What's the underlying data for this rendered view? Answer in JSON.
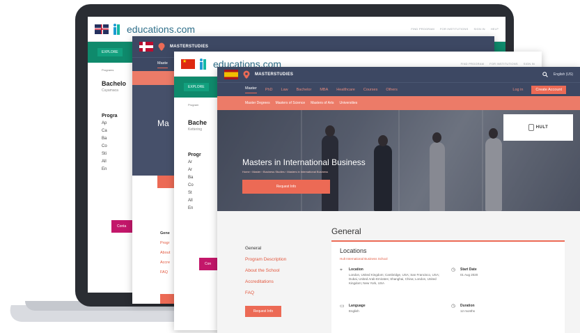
{
  "brand": {
    "logo_text": "educations.com",
    "ms_brand": "MASTERSTUDIES"
  },
  "colors": {
    "accent": "#ec6a55",
    "navy": "#3d4863",
    "green": "#0f8a6c",
    "magenta": "#c3176a",
    "laptop": "#2a2d33"
  },
  "back_window": {
    "top_links": [
      "FIND PROGRAM",
      "FOR INSTITUTIONS",
      "SIGN IN",
      "HELP"
    ],
    "green_pill": "EXPLORE",
    "crumb": "Programs",
    "title": "Bachelo",
    "subtitle": "Cuyamaca",
    "program_heading": "Progra",
    "program_list": [
      "Ap",
      "Ca",
      "Ba",
      "Co",
      "Sti",
      "All",
      "En"
    ],
    "contact_btn": "Conta"
  },
  "norway_window": {
    "ms_nav": [
      "Maste"
    ],
    "hero_title": "Ma",
    "side_nav": [
      "Gene",
      "Progr",
      "About",
      "Accre",
      "FAQ"
    ]
  },
  "china_window": {
    "top_links": [
      "FIND PROGRAM",
      "FOR INSTITUTIONS",
      "SIGN IN"
    ],
    "green_pill": "EXPLORE",
    "crumb": "Program",
    "title": "Bache",
    "subtitle": "Kettering",
    "program_heading": "Progr",
    "program_list": [
      "Ar",
      "Ar",
      "Ba",
      "Co",
      "St",
      "All",
      "En"
    ],
    "contact_btn": "Con"
  },
  "front_window": {
    "lang": "English (US)",
    "nav": [
      "Master",
      "PhD",
      "Law",
      "Bachelor",
      "MBA",
      "Healthcare",
      "Courses",
      "Others"
    ],
    "login": "Log in",
    "create_account": "Create Account",
    "sub_nav": [
      "Master Degrees",
      "Masters of Science",
      "Masters of Arts",
      "Universities"
    ],
    "school_logo": "HULT",
    "hero_title": "Masters in International Business",
    "hero_crumb": "Home › Master › Business Studies › Masters in International Business",
    "hero_btn": "Request Info",
    "section_title": "General",
    "side_nav": [
      "General",
      "Program Description",
      "About the School",
      "Accreditations",
      "FAQ"
    ],
    "side_request": "Request Info",
    "locations_title": "Locations",
    "locations_school": "Hult International Business School",
    "location_label": "Location",
    "location_value": "London, United Kingdom; Cambridge, USA; San Francisco, USA; Dubai, United Arab Emirates; Shanghai, China; London, United Kingdom; New York, USA",
    "start_label": "Start Date",
    "start_value": "01 Aug 2020",
    "language_label": "Language",
    "language_value": "English",
    "duration_label": "Duration",
    "duration_value": "12 months"
  },
  "icons": {
    "search": "search-icon",
    "pin": "map-pin-icon",
    "clock": "clock-icon",
    "chat": "language-icon"
  }
}
